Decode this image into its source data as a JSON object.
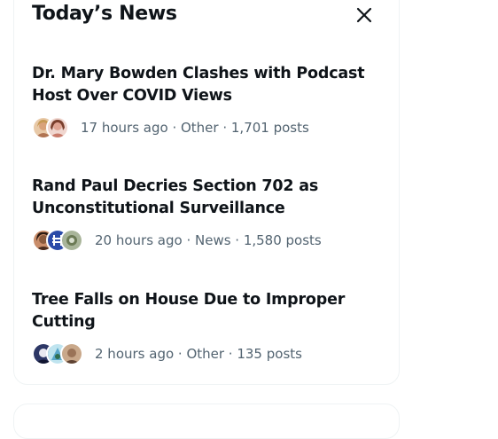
{
  "header": {
    "title": "Today’s News",
    "close_icon": "close-icon"
  },
  "stories": [
    {
      "title_line1": "Dr. Mary Bowden Clashes with Podcast",
      "title_line2": "Host Over COVID Views",
      "meta": "17 hours ago · Other · 1,701 posts",
      "avatar_colors": [
        "#d9a27a",
        "#c97b6b"
      ]
    },
    {
      "title_line1": "Rand Paul Decries Section 702 as",
      "title_line2": "Unconstitutional Surveillance",
      "meta": "20 hours ago · News · 1,580 posts",
      "avatar_colors": [
        "#8a5a3c",
        "#2a4aa8",
        "#6b7a55"
      ]
    },
    {
      "title_line1": "Tree Falls on House Due to Improper",
      "title_line2": "Cutting",
      "meta": "2 hours ago · Other · 135 posts",
      "avatar_colors": [
        "#2d3766",
        "#5aa7c9",
        "#9a7357"
      ]
    }
  ]
}
